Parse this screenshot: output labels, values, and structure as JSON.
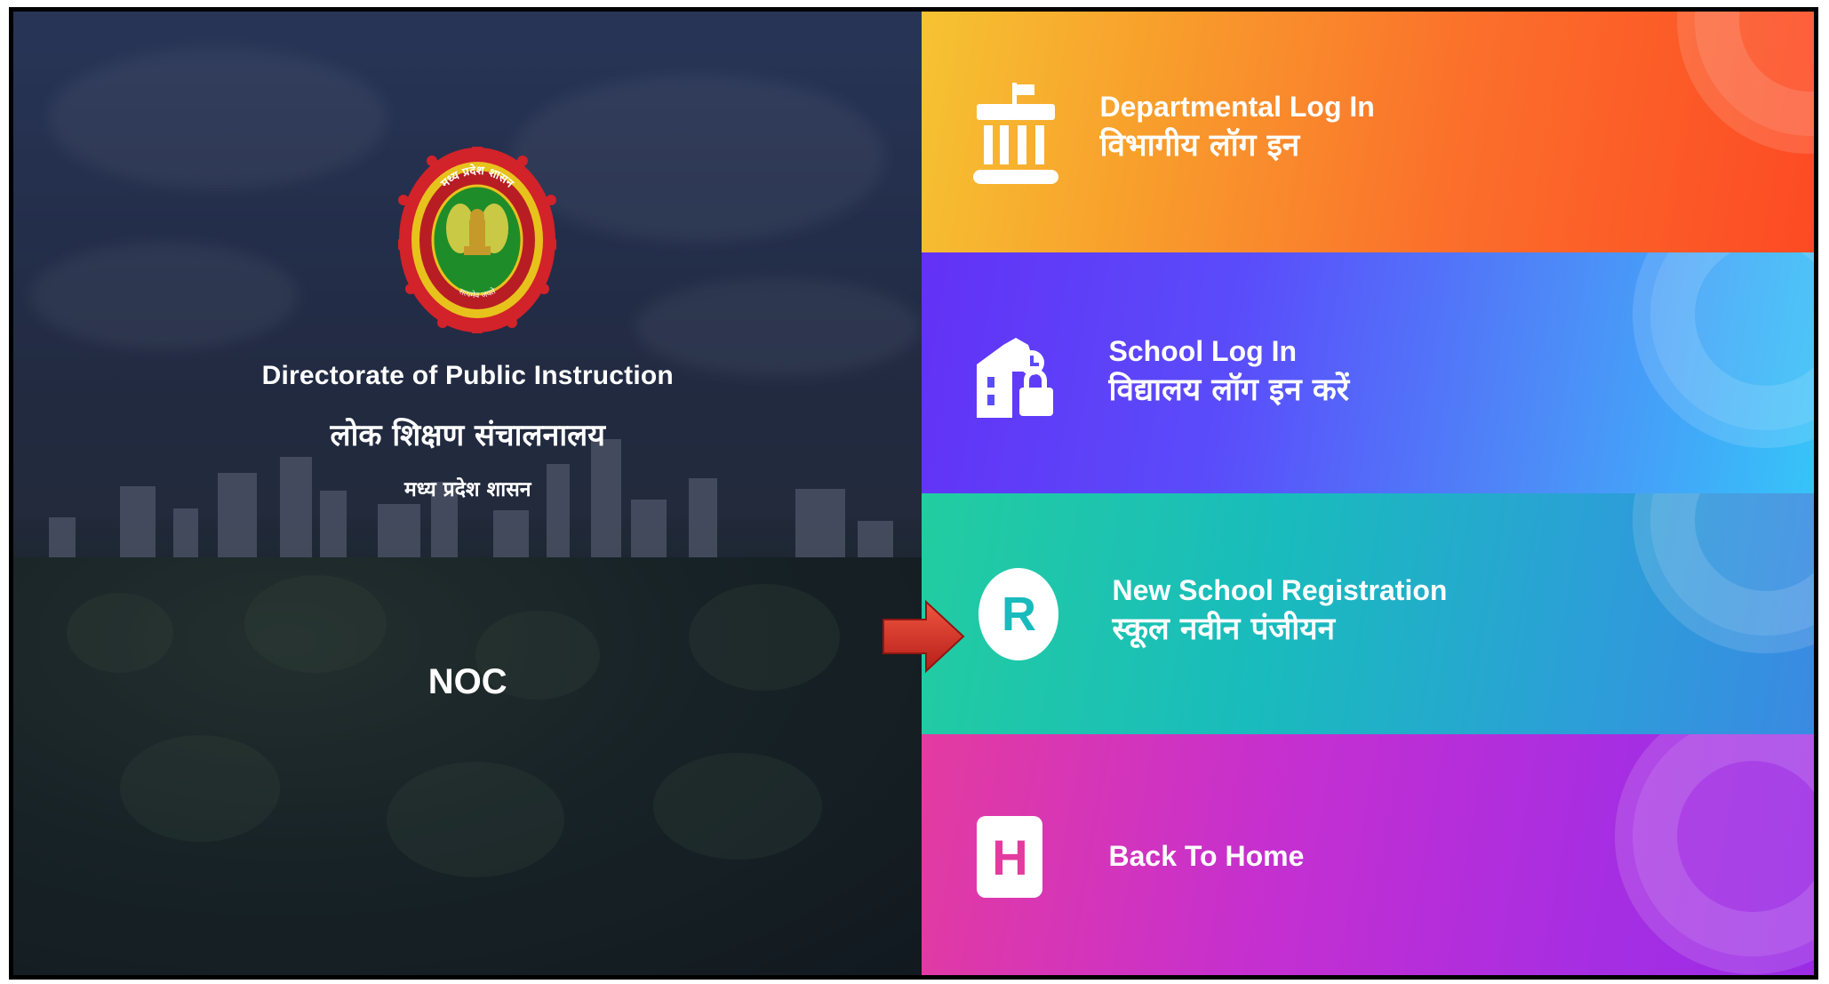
{
  "branding": {
    "org_name_en": "Directorate of Public Instruction",
    "org_name_hi": "लोक शिक्षण संचालनालय",
    "state_hi": "मध्य प्रदेश शासन",
    "app_name": "NOC",
    "emblem_text_top": "मध्य प्रदेश शासन",
    "emblem_text_bottom": "सत्यमेव जयते"
  },
  "tiles": [
    {
      "label_en": "Departmental Log In",
      "label_hi": "विभागीय लॉग इन",
      "icon": "building-icon"
    },
    {
      "label_en": "School Log In",
      "label_hi": "विद्यालय लॉग इन करें",
      "icon": "school-lock-icon"
    },
    {
      "label_en": "New School Registration",
      "label_hi": "स्कूल नवीन पंजीयन",
      "icon": "registration-icon",
      "icon_letter": "R"
    },
    {
      "label_en": "Back To Home",
      "label_hi": "",
      "icon": "home-icon",
      "icon_letter": "H"
    }
  ],
  "colors": {
    "departmental": "#fb6f2b",
    "school": "#5a4cfa",
    "registration": "#19bbbd",
    "home": "#c52fd0",
    "arrow": "#d8322a"
  }
}
